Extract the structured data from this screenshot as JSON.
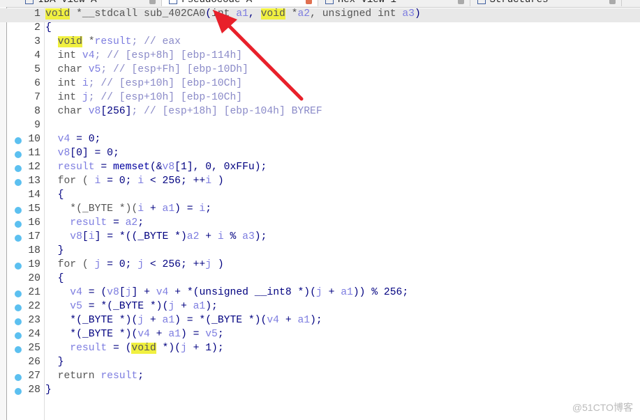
{
  "tabs": [
    {
      "label": "IDA View-A",
      "active": false
    },
    {
      "label": "Pseudocode-A",
      "active": true
    },
    {
      "label": "Hex View-1",
      "active": false
    },
    {
      "label": "Structures",
      "active": false
    }
  ],
  "colors": {
    "breakpoint": "#5cc0f0",
    "highlight": "#f0f040",
    "arrow": "#e8202a"
  },
  "lines": [
    {
      "n": "1",
      "bp": false,
      "cur": true,
      "t": [
        [
          "void",
          "h"
        ],
        [
          " *__stdcall sub_402CA0",
          "k"
        ],
        [
          "(",
          "p"
        ],
        [
          "int ",
          "k"
        ],
        [
          "a1",
          "v"
        ],
        [
          ", ",
          "p"
        ],
        [
          "void",
          "h"
        ],
        [
          " *",
          "k"
        ],
        [
          "a2",
          "v"
        ],
        [
          ", unsigned int ",
          "k"
        ],
        [
          "a3",
          "v"
        ],
        [
          ")",
          "p"
        ]
      ]
    },
    {
      "n": "2",
      "bp": false,
      "t": [
        [
          "{",
          "p"
        ]
      ]
    },
    {
      "n": "3",
      "bp": false,
      "t": [
        [
          "  ",
          ""
        ],
        [
          "void",
          "h"
        ],
        [
          " *",
          "k"
        ],
        [
          "result",
          "v"
        ],
        [
          "; // eax",
          "c"
        ]
      ]
    },
    {
      "n": "4",
      "bp": false,
      "t": [
        [
          "  int ",
          "k"
        ],
        [
          "v4",
          "v"
        ],
        [
          "; // [esp+8h] [ebp-114h]",
          "c"
        ]
      ]
    },
    {
      "n": "5",
      "bp": false,
      "t": [
        [
          "  char ",
          "k"
        ],
        [
          "v5",
          "v"
        ],
        [
          "; // [esp+Fh] [ebp-10Dh]",
          "c"
        ]
      ]
    },
    {
      "n": "6",
      "bp": false,
      "t": [
        [
          "  int ",
          "k"
        ],
        [
          "i",
          "v"
        ],
        [
          "; // [esp+10h] [ebp-10Ch]",
          "c"
        ]
      ]
    },
    {
      "n": "7",
      "bp": false,
      "t": [
        [
          "  int ",
          "k"
        ],
        [
          "j",
          "v"
        ],
        [
          "; // [esp+10h] [ebp-10Ch]",
          "c"
        ]
      ]
    },
    {
      "n": "8",
      "bp": false,
      "t": [
        [
          "  char ",
          "k"
        ],
        [
          "v8",
          "v"
        ],
        [
          "[256]",
          "p"
        ],
        [
          "; // [esp+18h] [ebp-104h] BYREF",
          "c"
        ]
      ]
    },
    {
      "n": "9",
      "bp": false,
      "t": []
    },
    {
      "n": "10",
      "bp": true,
      "t": [
        [
          "  ",
          ""
        ],
        [
          "v4",
          "v"
        ],
        [
          " = 0;",
          "p"
        ]
      ]
    },
    {
      "n": "11",
      "bp": true,
      "t": [
        [
          "  ",
          ""
        ],
        [
          "v8",
          "v"
        ],
        [
          "[0] = 0;",
          "p"
        ]
      ]
    },
    {
      "n": "12",
      "bp": true,
      "t": [
        [
          "  ",
          ""
        ],
        [
          "result",
          "v"
        ],
        [
          " = ",
          "p"
        ],
        [
          "memset",
          "f"
        ],
        [
          "(&",
          "p"
        ],
        [
          "v8",
          "v"
        ],
        [
          "[1], 0, 0xFFu);",
          "p"
        ]
      ]
    },
    {
      "n": "13",
      "bp": true,
      "t": [
        [
          "  for ( ",
          "k"
        ],
        [
          "i",
          "v"
        ],
        [
          " = 0; ",
          "p"
        ],
        [
          "i",
          "v"
        ],
        [
          " < 256; ++",
          "p"
        ],
        [
          "i",
          "v"
        ],
        [
          " )",
          "p"
        ]
      ]
    },
    {
      "n": "14",
      "bp": false,
      "t": [
        [
          "  {",
          "p"
        ]
      ]
    },
    {
      "n": "15",
      "bp": true,
      "t": [
        [
          "    *(_BYTE *)(",
          "k"
        ],
        [
          "i",
          "v"
        ],
        [
          " + ",
          "p"
        ],
        [
          "a1",
          "v"
        ],
        [
          ") = ",
          "p"
        ],
        [
          "i",
          "v"
        ],
        [
          ";",
          "p"
        ]
      ]
    },
    {
      "n": "16",
      "bp": true,
      "t": [
        [
          "    ",
          ""
        ],
        [
          "result",
          "v"
        ],
        [
          " = ",
          "p"
        ],
        [
          "a2",
          "v"
        ],
        [
          ";",
          "p"
        ]
      ]
    },
    {
      "n": "17",
      "bp": true,
      "t": [
        [
          "    ",
          ""
        ],
        [
          "v8",
          "v"
        ],
        [
          "[",
          "p"
        ],
        [
          "i",
          "v"
        ],
        [
          "] = *((_BYTE *)",
          "p"
        ],
        [
          "a2",
          "v"
        ],
        [
          " + ",
          "p"
        ],
        [
          "i",
          "v"
        ],
        [
          " % ",
          "p"
        ],
        [
          "a3",
          "v"
        ],
        [
          ");",
          "p"
        ]
      ]
    },
    {
      "n": "18",
      "bp": false,
      "t": [
        [
          "  }",
          "p"
        ]
      ]
    },
    {
      "n": "19",
      "bp": true,
      "t": [
        [
          "  for ( ",
          "k"
        ],
        [
          "j",
          "v"
        ],
        [
          " = 0; ",
          "p"
        ],
        [
          "j",
          "v"
        ],
        [
          " < 256; ++",
          "p"
        ],
        [
          "j",
          "v"
        ],
        [
          " )",
          "p"
        ]
      ]
    },
    {
      "n": "20",
      "bp": false,
      "t": [
        [
          "  {",
          "p"
        ]
      ]
    },
    {
      "n": "21",
      "bp": true,
      "t": [
        [
          "    ",
          ""
        ],
        [
          "v4",
          "v"
        ],
        [
          " = (",
          "p"
        ],
        [
          "v8",
          "v"
        ],
        [
          "[",
          "p"
        ],
        [
          "j",
          "v"
        ],
        [
          "] + ",
          "p"
        ],
        [
          "v4",
          "v"
        ],
        [
          " + *(unsigned __int8 *)(",
          "p"
        ],
        [
          "j",
          "v"
        ],
        [
          " + ",
          "p"
        ],
        [
          "a1",
          "v"
        ],
        [
          ")) % 256;",
          "p"
        ]
      ]
    },
    {
      "n": "22",
      "bp": true,
      "t": [
        [
          "    ",
          ""
        ],
        [
          "v5",
          "v"
        ],
        [
          " = *(_BYTE *)(",
          "p"
        ],
        [
          "j",
          "v"
        ],
        [
          " + ",
          "p"
        ],
        [
          "a1",
          "v"
        ],
        [
          ");",
          "p"
        ]
      ]
    },
    {
      "n": "23",
      "bp": true,
      "t": [
        [
          "    *(_BYTE *)(",
          "p"
        ],
        [
          "j",
          "v"
        ],
        [
          " + ",
          "p"
        ],
        [
          "a1",
          "v"
        ],
        [
          ") = *(_BYTE *)(",
          "p"
        ],
        [
          "v4",
          "v"
        ],
        [
          " + ",
          "p"
        ],
        [
          "a1",
          "v"
        ],
        [
          ");",
          "p"
        ]
      ]
    },
    {
      "n": "24",
      "bp": true,
      "t": [
        [
          "    *(_BYTE *)(",
          "p"
        ],
        [
          "v4",
          "v"
        ],
        [
          " + ",
          "p"
        ],
        [
          "a1",
          "v"
        ],
        [
          ") = ",
          "p"
        ],
        [
          "v5",
          "v"
        ],
        [
          ";",
          "p"
        ]
      ]
    },
    {
      "n": "25",
      "bp": true,
      "t": [
        [
          "    ",
          ""
        ],
        [
          "result",
          "v"
        ],
        [
          " = (",
          "p"
        ],
        [
          "void",
          "h"
        ],
        [
          " *)(",
          "p"
        ],
        [
          "j",
          "v"
        ],
        [
          " + 1);",
          "p"
        ]
      ]
    },
    {
      "n": "26",
      "bp": false,
      "t": [
        [
          "  }",
          "p"
        ]
      ]
    },
    {
      "n": "27",
      "bp": true,
      "t": [
        [
          "  return ",
          "k"
        ],
        [
          "result",
          "v"
        ],
        [
          ";",
          "p"
        ]
      ]
    },
    {
      "n": "28",
      "bp": true,
      "t": [
        [
          "}",
          "p"
        ]
      ]
    }
  ],
  "watermark": "@51CTO博客"
}
